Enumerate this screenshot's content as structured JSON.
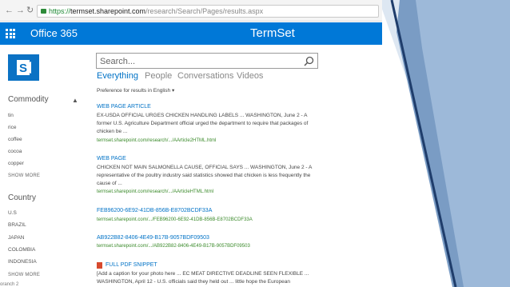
{
  "browser": {
    "url_secure": "https://",
    "url_host": "termset.sharepoint.com",
    "url_path": "/research/Search/Pages/results.aspx"
  },
  "suite": {
    "app_title": "Office 365",
    "site_title": "TermSet"
  },
  "facets": {
    "commodity": {
      "title": "Commodity",
      "items": [
        "tin",
        "rice",
        "coffee",
        "cocoa",
        "copper"
      ],
      "more": "SHOW MORE"
    },
    "country": {
      "title": "Country",
      "items": [
        "U.S",
        "BRAZIL",
        "JAPAN",
        "COLOMBIA",
        "INDONESIA"
      ],
      "more": "SHOW MORE"
    },
    "cut_off_text": "oranch 2"
  },
  "search": {
    "placeholder": "Search..."
  },
  "verticals": [
    "Everything",
    "People",
    "Conversations",
    "Videos"
  ],
  "preference": "Preference for results in English",
  "results": [
    {
      "title": "WEB PAGE ARTICLE",
      "snippet": "EX-USDA OFFICIAL URGES CHICKEN HANDLING LABELS ... WASHINGTON, June 2 - A former U.S. Agriculture Department official urged the department to require that packages of chicken be ...",
      "url": "termset.sharepoint.com/research/.../AArticle2HTML.html"
    },
    {
      "title": "WEB PAGE",
      "snippet": "CHICKEN NOT MAIN SALMONELLA CAUSE, OFFICIAL SAYS ... WASHINGTON, June 2 - A representative of the poultry industry said statistics showed that chicken is less frequently the cause of ...",
      "url": "termset.sharepoint.com/research/.../AArticleHTML.html"
    },
    {
      "title": "FEB96200-6E92-41DB-856B-E8702BCDF33A",
      "url": "termset.sharepoint.com/.../FEB96200-6E92-41DB-856B-E8702BCDF33A"
    },
    {
      "title": "AB922B82-8406-4E49-B17B-9057BDF09503",
      "url": "termset.sharepoint.com/.../AB922B82-8406-4E49-B17B-9057BDF09503"
    },
    {
      "title": "FULL PDF SNIPPET",
      "snippet": "[Add a caption for your photo here ... EC MEAT DIRECTIVE DEADLINE SEEN FLEXIBLE ... WASHINGTON, April 12 - U.S. officials said they held out ... little hope the European"
    }
  ],
  "colors": {
    "suite_bar": "#0078d7",
    "link": "#0072c6",
    "url_green": "#3a8a2a",
    "deco_light": "#d7e3f0",
    "deco_dark": "#1f3d6b"
  }
}
